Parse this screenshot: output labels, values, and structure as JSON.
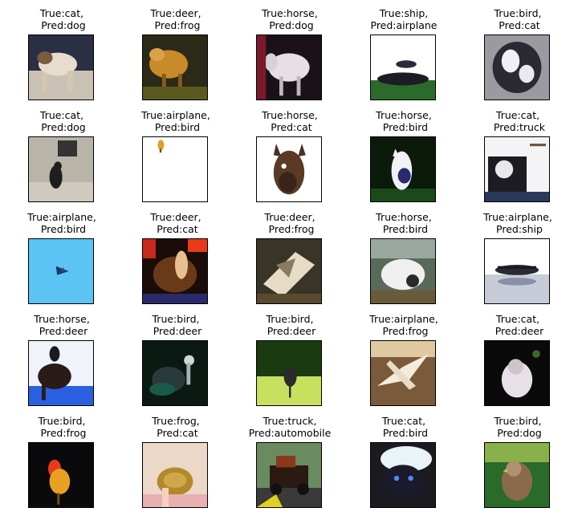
{
  "figure": {
    "rows": 5,
    "cols": 5,
    "items": [
      {
        "label": "True:cat,\n Pred:dog",
        "icon": "cat-dog-photo"
      },
      {
        "label": "True:deer,\n Pred:frog",
        "icon": "deer-photo"
      },
      {
        "label": "True:horse,\n Pred:dog",
        "icon": "horse-photo"
      },
      {
        "label": "True:ship,\nPred:airplane",
        "icon": "ship-photo"
      },
      {
        "label": "True:bird,\n Pred:cat",
        "icon": "bird-photo"
      },
      {
        "label": "True:cat,\n Pred:dog",
        "icon": "cat-photo"
      },
      {
        "label": "True:airplane,\n Pred:bird",
        "icon": "airplane-photo"
      },
      {
        "label": "True:horse,\n Pred:cat",
        "icon": "horse-head-photo"
      },
      {
        "label": "True:horse,\n Pred:bird",
        "icon": "horse-photo"
      },
      {
        "label": "True:cat,\n Pred:truck",
        "icon": "cat-photo"
      },
      {
        "label": "True:airplane,\n Pred:bird",
        "icon": "airplane-sky-photo"
      },
      {
        "label": "True:deer,\n Pred:cat",
        "icon": "deer-photo"
      },
      {
        "label": "True:deer,\n Pred:frog",
        "icon": "deer-photo"
      },
      {
        "label": "True:horse,\n Pred:bird",
        "icon": "horse-photo"
      },
      {
        "label": "True:airplane,\n Pred:ship",
        "icon": "airplane-photo"
      },
      {
        "label": "True:horse,\n Pred:deer",
        "icon": "horse-rider-photo"
      },
      {
        "label": "True:bird,\n Pred:deer",
        "icon": "bird-photo"
      },
      {
        "label": "True:bird,\n Pred:deer",
        "icon": "bird-grass-photo"
      },
      {
        "label": "True:airplane,\n Pred:frog",
        "icon": "airplane-photo"
      },
      {
        "label": "True:cat,\n Pred:deer",
        "icon": "cat-photo"
      },
      {
        "label": "True:bird,\n Pred:frog",
        "icon": "bird-photo"
      },
      {
        "label": "True:frog,\n Pred:cat",
        "icon": "frog-photo"
      },
      {
        "label": "True:truck,\nPred:automobile",
        "icon": "truck-photo"
      },
      {
        "label": "True:cat,\n Pred:bird",
        "icon": "cat-photo"
      },
      {
        "label": "True:bird,\n Pred:dog",
        "icon": "bird-photo"
      }
    ]
  }
}
